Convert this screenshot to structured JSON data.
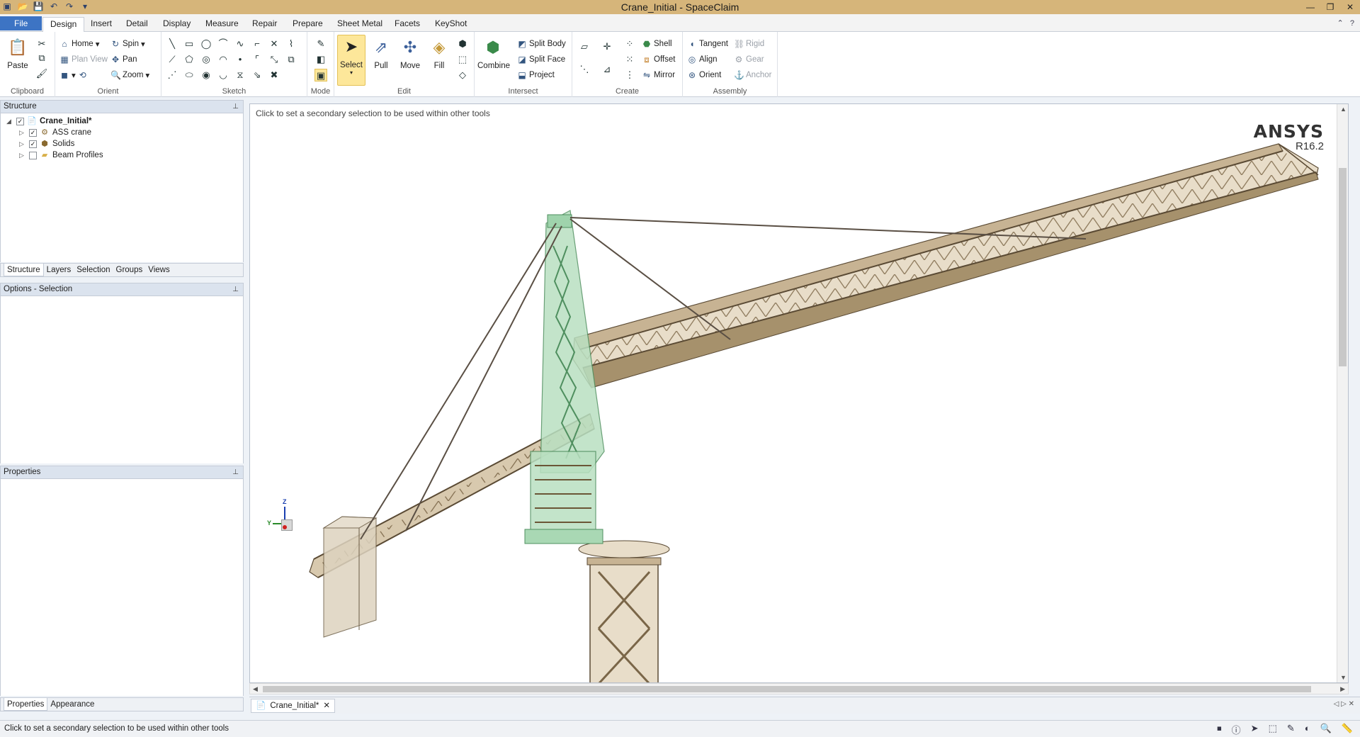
{
  "window": {
    "title": "Crane_Initial - SpaceClaim",
    "controls": [
      "minimize-icon",
      "restore-icon",
      "close-icon"
    ]
  },
  "ribbon_tabs": [
    "File",
    "Design",
    "Insert",
    "Detail",
    "Display",
    "Measure",
    "Repair",
    "Prepare",
    "Sheet Metal",
    "Facets",
    "KeyShot"
  ],
  "active_tab": "Design",
  "ribbon": {
    "clipboard": {
      "label": "Clipboard",
      "paste": "Paste"
    },
    "orient": {
      "label": "Orient",
      "home": "Home",
      "spin": "Spin",
      "plan_view": "Plan View",
      "pan": "Pan",
      "zoom": "Zoom"
    },
    "sketch": {
      "label": "Sketch"
    },
    "mode": {
      "label": "Mode"
    },
    "edit": {
      "label": "Edit",
      "select": "Select",
      "pull": "Pull",
      "move": "Move",
      "fill": "Fill"
    },
    "intersect": {
      "label": "Intersect",
      "combine": "Combine",
      "split_body": "Split Body",
      "split_face": "Split Face",
      "project": "Project"
    },
    "create": {
      "label": "Create",
      "shell": "Shell",
      "offset": "Offset",
      "mirror": "Mirror"
    },
    "assembly": {
      "label": "Assembly",
      "tangent": "Tangent",
      "align": "Align",
      "orient": "Orient",
      "rigid": "Rigid",
      "gear": "Gear",
      "anchor": "Anchor"
    }
  },
  "structure_panel": {
    "title": "Structure",
    "tree": [
      {
        "label": "Crane_Initial*",
        "checked": true,
        "bold": true,
        "level": 0
      },
      {
        "label": "ASS crane",
        "checked": true,
        "level": 1
      },
      {
        "label": "Solids",
        "checked": true,
        "level": 1
      },
      {
        "label": "Beam Profiles",
        "checked": false,
        "level": 1
      }
    ],
    "tabs": [
      "Structure",
      "Layers",
      "Selection",
      "Groups",
      "Views"
    ]
  },
  "options_panel": {
    "title": "Options - Selection"
  },
  "properties_panel": {
    "title": "Properties",
    "tabs": [
      "Properties",
      "Appearance"
    ]
  },
  "viewport": {
    "hint": "Click to set a secondary selection to be used within other tools",
    "brand": "ANSYS",
    "version": "R16.2",
    "triad": {
      "z": "Z",
      "y": "Y"
    }
  },
  "document_tab": "Crane_Initial*",
  "status_bar": {
    "text": "Click to set a secondary selection to be used within other tools"
  },
  "colors": {
    "accent": "#3d74c4",
    "titlebar": "#d6b57a",
    "selected_tower": "#a9d8b4",
    "steel": "#b9a58a"
  }
}
